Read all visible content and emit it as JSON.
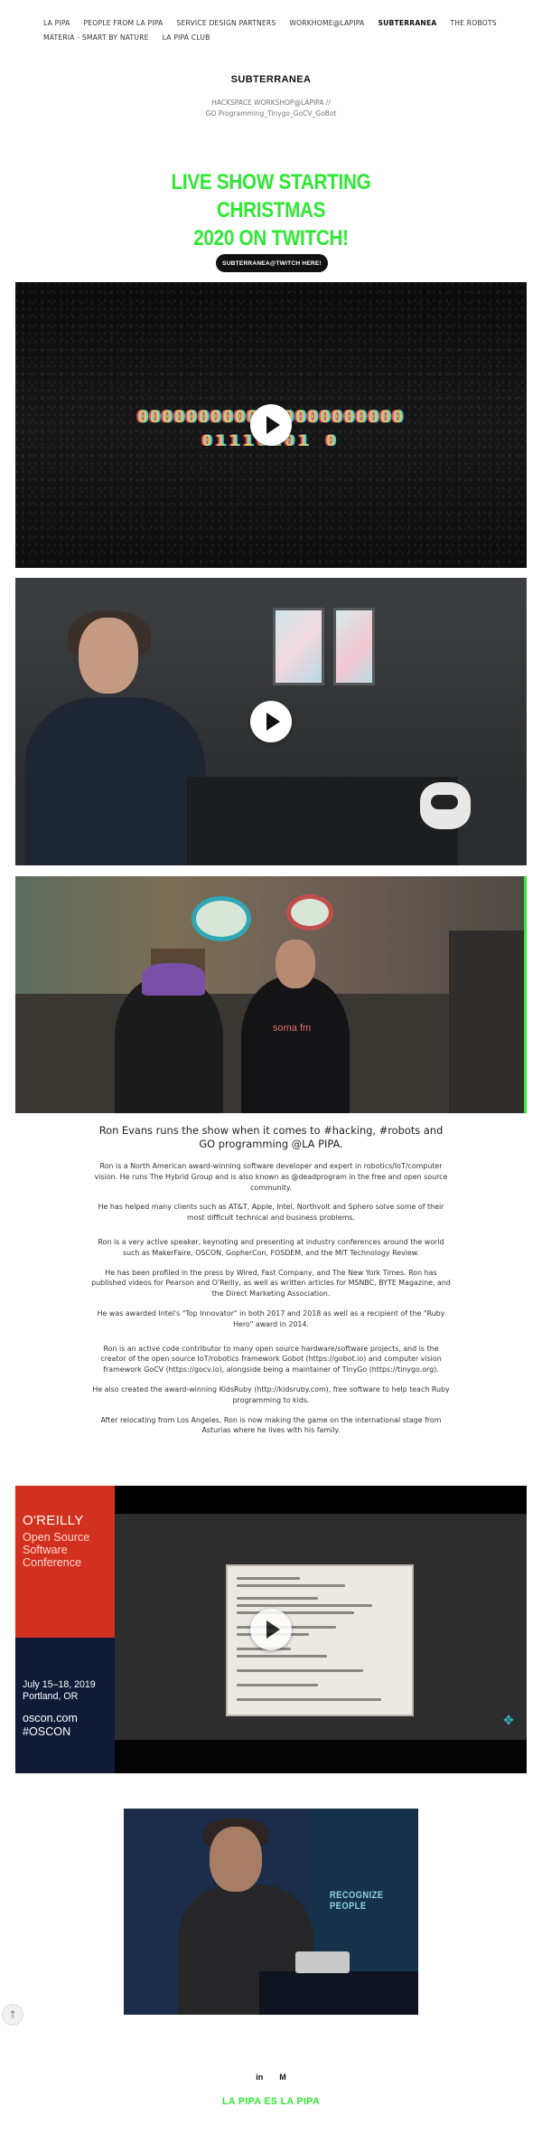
{
  "nav": {
    "items": [
      {
        "label": "LA PIPA"
      },
      {
        "label": "PEOPLE FROM LA PIPA"
      },
      {
        "label": "SERVICE DESIGN PARTNERS"
      },
      {
        "label": "WORKHOME@LAPIPA"
      },
      {
        "label": "SUBTERRANEA",
        "active": true
      },
      {
        "label": "THE ROBOTS"
      },
      {
        "label": "MATERIA - SMART BY NATURE"
      },
      {
        "label": "LA PIPA CLUB"
      }
    ]
  },
  "page": {
    "title": "SUBTERRANEA",
    "subtitle_line1": "HACKSPACE WORKSHOP@LAPIPA //",
    "subtitle_line2": "GO Programming_Tinygo_GoCV_GoBot",
    "headline_line1": "LIVE SHOW STARTING CHRISTMAS",
    "headline_line2": "2020 ON TWITCH!",
    "cta_label": "SUBTERRANEA@TWITCH HERE!"
  },
  "glitch": {
    "row1": "0000000000000000000000",
    "row2": "01110101 0"
  },
  "photo3": {
    "shirt_text": "soma fm"
  },
  "bio": {
    "lead": "Ron Evans runs the show when it comes to #hacking, #robots and GO programming @LA PIPA.",
    "paragraphs": [
      "Ron is a North American award-winning software developer and expert in robotics/IoT/computer vision. He runs The Hybrid Group and is also known as @deadprogram in the free and open source community.",
      "He has helped many clients such as AT&T, Apple, Intel, Northvolt and Sphero solve some of their most difficult technical and business problems.",
      "Ron is a very active speaker, keynoting and presenting at industry conferences around the world such as MakerFaire, OSCON, GopherCon, FOSDEM, and the MIT Technology Review.",
      "He has been profiled in the press by Wired, Fast Company, and The New York Times. Ron has published videos for Pearson and O'Reilly, as well as written articles for MSNBC, BYTE Magazine, and the Direct Marketing Association.",
      "He was awarded Intel's \"Top Innovator\" in both 2017 and 2018 as well as a recipient of the \"Ruby Hero\" award in 2014.",
      "Ron is an active code contributor to many open source hardware/software projects, and is the creator of the open source IoT/robotics framework Gobot (https://gobot.io) and computer vision framework GoCV (https://gocv.io), alongside being a maintainer of TinyGo (https://tinygo.org).",
      "He also created the award-winning KidsRuby (http://kidsruby.com), free software to help teach Ruby programming to kids.",
      "After relocating from Los Angeles, Ron is now making the game on the international stage from Asturias where he lives with his family."
    ]
  },
  "oscon": {
    "brand": "O'REILLY",
    "conf_line1": "Open Source",
    "conf_line2": "Software",
    "conf_line3": "Conference",
    "date_line1": "July 15–18, 2019",
    "date_line2": "Portland, OR",
    "site_line1": "oscon.com",
    "site_line2": "#OSCON"
  },
  "photo5": {
    "banner_text": "RECOGNIZE PEOPLE"
  },
  "controls": {
    "scroll_top_glyph": "↑"
  },
  "social": {
    "linkedin": "in",
    "medium": "M"
  },
  "footer": {
    "text": "LA PIPA ES LA PIPA"
  },
  "colors": {
    "accent_green": "#2ee833",
    "button_dark": "#111111"
  }
}
